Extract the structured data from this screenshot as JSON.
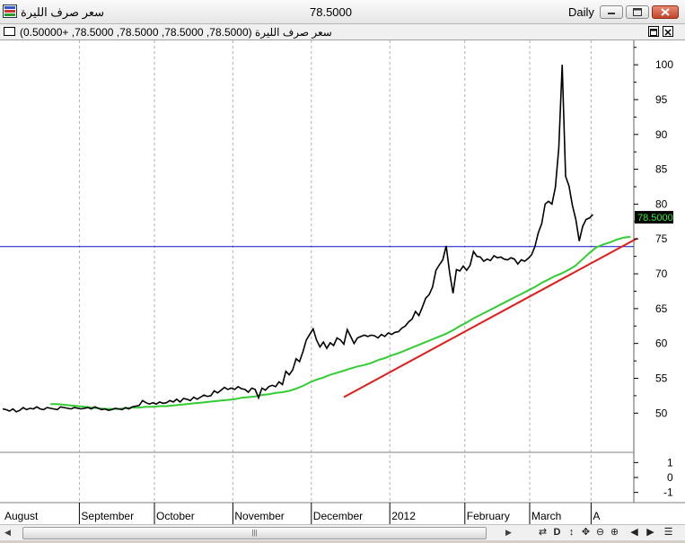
{
  "window": {
    "title": "سعر صرف الليرة",
    "price": "78.5000",
    "period": "Daily"
  },
  "subwindow": {
    "legend": "سعر صرف الليرة (78.5000, 78.5000, 78.5000, 78.5000, +0.50000)"
  },
  "colors": {
    "price_line": "#000000",
    "moving_average": "#33cc33",
    "trend_line": "#e21b1b",
    "horizontal_line": "#1010c8",
    "price_tag_bg": "#000000",
    "price_tag_fg": "#33ee33"
  },
  "toolbar": {
    "icons": [
      "sync-icon",
      "daily-period-icon",
      "move-vertical-icon",
      "move-icon",
      "zoom-out-icon",
      "zoom-in-icon",
      "scroll-left-icon",
      "scroll-right-icon",
      "menu-icon"
    ],
    "daily_label": "D"
  },
  "chart_data": {
    "type": "line",
    "last_value_label": "78.5000",
    "x_months": [
      "August",
      "September",
      "October",
      "November",
      "December",
      "2012",
      "February",
      "March",
      "A"
    ],
    "month_start_index": [
      0,
      23,
      45,
      68,
      91,
      114,
      136,
      155,
      173
    ],
    "y_ticks": [
      50,
      55,
      60,
      65,
      70,
      75,
      80,
      85,
      90,
      95,
      100
    ],
    "ylim": [
      44.5,
      103.5
    ],
    "grid": true,
    "series": [
      {
        "style": "black-line",
        "values": [
          50.6,
          50.5,
          50.3,
          50.6,
          50.2,
          50.4,
          50.8,
          50.5,
          50.7,
          50.6,
          50.9,
          50.6,
          50.5,
          50.8,
          50.7,
          50.6,
          50.5,
          50.9,
          50.8,
          50.7,
          50.6,
          50.8,
          50.7,
          50.6,
          50.7,
          50.8,
          50.6,
          50.9,
          50.7,
          50.5,
          50.6,
          50.4,
          50.5,
          50.7,
          50.6,
          50.5,
          50.8,
          50.6,
          50.9,
          51.0,
          51.1,
          51.8,
          51.5,
          51.3,
          51.5,
          51.3,
          51.6,
          51.4,
          51.5,
          51.8,
          51.6,
          52.0,
          51.6,
          52.1,
          52.0,
          51.8,
          52.3,
          52.0,
          52.3,
          52.6,
          52.4,
          52.5,
          53.2,
          52.9,
          53.3,
          53.7,
          53.4,
          53.6,
          53.4,
          53.8,
          53.5,
          53.4,
          53.0,
          53.6,
          53.4,
          52.2,
          53.6,
          53.3,
          53.8,
          54.0,
          53.8,
          54.5,
          54.1,
          56.0,
          55.5,
          56.2,
          57.8,
          57.4,
          58.8,
          60.5,
          61.3,
          62.1,
          60.5,
          59.5,
          60.2,
          59.3,
          60.1,
          59.7,
          60.8,
          60.5,
          59.9,
          62.0,
          61.0,
          60.0,
          60.8,
          61.0,
          61.2,
          61.0,
          61.2,
          61.1,
          60.8,
          61.3,
          61.0,
          61.5,
          61.3,
          61.6,
          61.7,
          62.2,
          62.5,
          63.1,
          63.5,
          64.6,
          64.0,
          65.2,
          66.5,
          67.0,
          68.1,
          70.5,
          71.3,
          72.0,
          74.0,
          70.2,
          67.2,
          70.6,
          70.4,
          71.1,
          70.5,
          71.2,
          73.2,
          72.5,
          72.4,
          71.8,
          72.1,
          71.9,
          72.6,
          72.3,
          72.4,
          72.1,
          72.0,
          72.3,
          72.1,
          71.4,
          72.0,
          71.8,
          72.2,
          72.7,
          73.9,
          75.9,
          77.2,
          80.0,
          80.4,
          80.0,
          82.4,
          88.0,
          100.0,
          84.0,
          82.6,
          79.8,
          77.8,
          74.7,
          76.8,
          77.8,
          78.0,
          78.5
        ]
      },
      {
        "style": "green-line",
        "values": [
          51.3,
          51.3,
          51.2,
          51.1,
          51.0,
          50.9,
          50.8,
          50.7,
          50.6,
          50.6,
          50.6,
          50.7,
          50.8,
          50.8,
          50.9,
          50.9,
          51.0,
          51.0,
          51.1,
          51.2,
          51.3,
          51.4,
          51.5,
          51.6,
          51.7,
          51.8,
          51.9,
          52.0,
          52.2,
          52.3,
          52.4,
          52.6,
          52.7,
          52.9,
          53.0,
          53.2,
          53.5,
          53.9,
          54.4,
          54.8,
          55.1,
          55.5,
          55.8,
          56.1,
          56.4,
          56.7,
          56.9,
          57.2,
          57.6,
          57.9,
          58.3,
          58.6,
          59.0,
          59.4,
          59.8,
          60.2,
          60.6,
          61.0,
          61.4,
          61.9,
          62.5,
          63.0,
          63.6,
          64.1,
          64.6,
          65.1,
          65.6,
          66.1,
          66.6,
          67.1,
          67.6,
          68.1,
          68.7,
          69.2,
          69.7,
          70.1,
          70.6,
          71.2,
          72.1,
          73.0,
          73.8,
          74.2,
          74.5,
          74.9,
          75.2,
          75.3
        ]
      },
      {
        "style": "red-line",
        "start": {
          "x": 100,
          "y": 52.3
        },
        "end": {
          "x": 186,
          "y": 75.1
        }
      },
      {
        "style": "blue-horizontal",
        "y": 73.9
      }
    ],
    "lower_panel": {
      "y_ticks": [
        1,
        0,
        -1
      ],
      "ylim": [
        -1.5,
        1.5
      ]
    }
  }
}
